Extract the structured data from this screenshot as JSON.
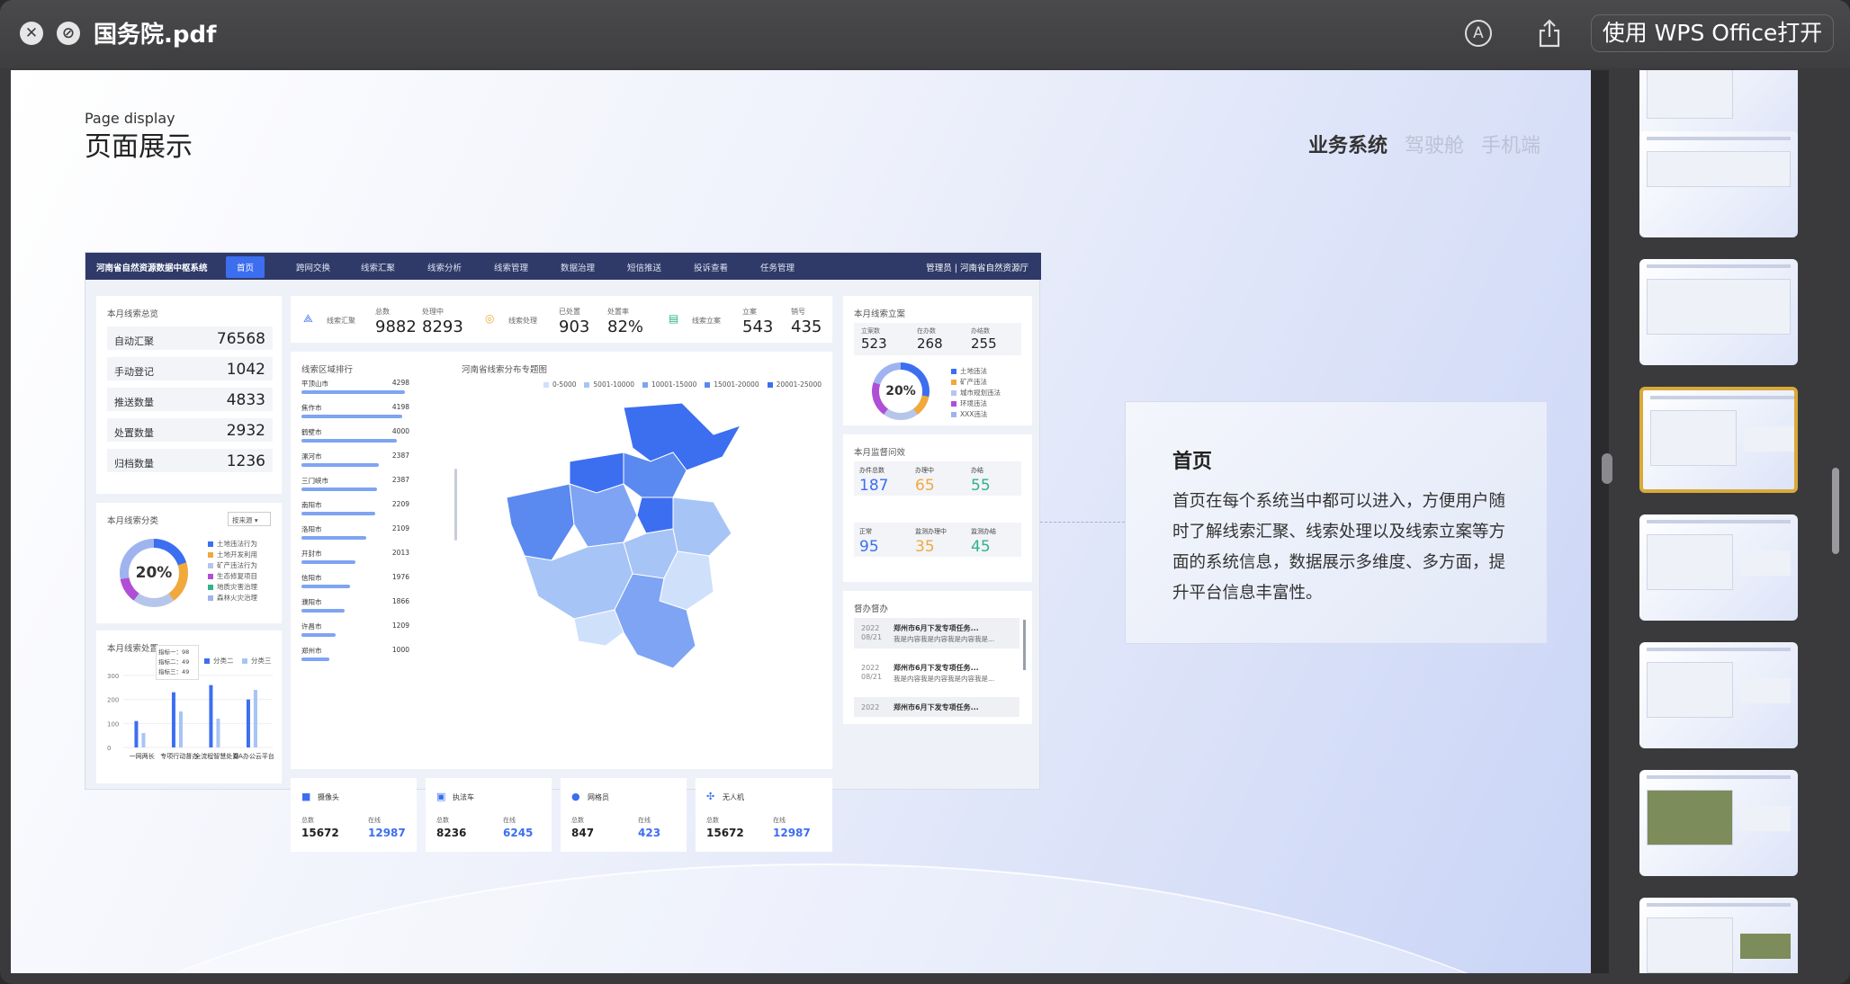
{
  "window": {
    "title": "国务院.pdf",
    "open_with_label": "使用 WPS Office打开",
    "close_icon": "close-icon",
    "sidebar_toggle_icon": "compass-icon",
    "annotate_icon": "markup-icon",
    "share_icon": "share-icon"
  },
  "slide": {
    "heading_en": "Page display",
    "heading_cn": "页面展示",
    "tabs": [
      {
        "label": "业务系统",
        "active": true
      },
      {
        "label": "驾驶舱",
        "active": false
      },
      {
        "label": "手机端",
        "active": false
      }
    ],
    "description": {
      "title": "首页",
      "body": "首页在每个系统当中都可以进入，方便用户随时了解线索汇聚、线索处理以及线索立案等方面的系统信息，数据展示多维度、多方面，提升平台信息丰富性。"
    }
  },
  "mock": {
    "brand": "河南省自然资源数据中枢系统",
    "nav": [
      "首页",
      "跨网交换",
      "线索汇聚",
      "线索分析",
      "线索管理",
      "数据治理",
      "短信推送",
      "投诉查看",
      "任务管理"
    ],
    "user": "管理员 | 河南省自然资源厅",
    "summary": {
      "title": "本月线索总览",
      "rows": [
        {
          "label": "自动汇聚",
          "value": "76568"
        },
        {
          "label": "手动登记",
          "value": "1042"
        },
        {
          "label": "推送数量",
          "value": "4833"
        },
        {
          "label": "处置数量",
          "value": "2932"
        },
        {
          "label": "归档数量",
          "value": "1236"
        }
      ]
    },
    "classify": {
      "title": "本月线索分类",
      "dropdown": "按来源",
      "percent": "20%",
      "legend": [
        "土地违法行为",
        "土地开发利用",
        "矿产违法行为",
        "生态修复项目",
        "地质灾害治理",
        "森林火灾治理"
      ]
    },
    "kpis": [
      {
        "name": "线索汇聚",
        "items": [
          {
            "label": "总数",
            "value": "9882"
          },
          {
            "label": "处理中",
            "value": "8293"
          }
        ]
      },
      {
        "name": "线索处理",
        "items": [
          {
            "label": "已处置",
            "value": "903"
          },
          {
            "label": "处置率",
            "value": "82%"
          }
        ]
      },
      {
        "name": "线索立案",
        "items": [
          {
            "label": "立案",
            "value": "543"
          },
          {
            "label": "销号",
            "value": "435"
          }
        ]
      }
    ],
    "ranking": {
      "title": "线索区域排行",
      "rows": [
        {
          "name": "平顶山市",
          "value": "4298"
        },
        {
          "name": "焦作市",
          "value": "4198"
        },
        {
          "name": "鹤壁市",
          "value": "4000"
        },
        {
          "name": "漯河市",
          "value": "2387"
        },
        {
          "name": "三门峡市",
          "value": "2387"
        },
        {
          "name": "南阳市",
          "value": "2209"
        },
        {
          "name": "洛阳市",
          "value": "2109"
        },
        {
          "name": "开封市",
          "value": "2013"
        },
        {
          "name": "信阳市",
          "value": "1976"
        },
        {
          "name": "濮阳市",
          "value": "1866"
        },
        {
          "name": "许昌市",
          "value": "1209"
        },
        {
          "name": "郑州市",
          "value": "1000"
        }
      ],
      "bar_fractions": [
        0.96,
        0.93,
        0.88,
        0.72,
        0.7,
        0.68,
        0.6,
        0.5,
        0.45,
        0.4,
        0.32,
        0.26
      ]
    },
    "map": {
      "title": "河南省线索分布专题图",
      "legend": [
        "0-5000",
        "5001-10000",
        "10001-15000",
        "15001-20000",
        "20001-25000"
      ],
      "colors": [
        "#cfe0fb",
        "#a7c4f6",
        "#7ea4f3",
        "#5a89ef",
        "#3c6ef0"
      ]
    },
    "filing": {
      "title": "本月线索立案",
      "items": [
        {
          "label": "立案数",
          "value": "523"
        },
        {
          "label": "在办数",
          "value": "268"
        },
        {
          "label": "办结数",
          "value": "255"
        }
      ],
      "percent": "20%",
      "legend": [
        "土地违法",
        "矿产违法",
        "城市规划违法",
        "环境违法",
        "XXX违法"
      ]
    },
    "supervision": {
      "title": "本月监督问效",
      "items": [
        {
          "label": "办件总数",
          "value": "187",
          "color": "#3c6ef0"
        },
        {
          "label": "办理中",
          "value": "65",
          "color": "#f0a93c"
        },
        {
          "label": "办结",
          "value": "55",
          "color": "#2fb38a"
        },
        {
          "label": "正常",
          "value": "95",
          "color": "#3c6ef0"
        },
        {
          "label": "监测办理中",
          "value": "35",
          "color": "#f0a93c"
        },
        {
          "label": "监测办结",
          "value": "45",
          "color": "#2fb38a"
        }
      ]
    },
    "notices": {
      "title": "督办督办",
      "items": [
        {
          "year": "2022",
          "date": "08/21",
          "title": "郑州市6月下发专项任务...",
          "desc": "我是内容我是内容我是内容我是..."
        },
        {
          "year": "2022",
          "date": "08/21",
          "title": "郑州市6月下发专项任务...",
          "desc": "我是内容我是内容我是内容我是..."
        },
        {
          "year": "2022",
          "date": "",
          "title": "郑州市6月下发专项任务...",
          "desc": ""
        }
      ]
    },
    "handling": {
      "title": "本月线索处置",
      "legend": [
        "分类二",
        "分类三"
      ],
      "tooltip": [
        "指标一：98",
        "指标二：49",
        "指标三：49"
      ],
      "yticks": [
        "300",
        "200",
        "100",
        "0"
      ],
      "categories": [
        "一网两长",
        "专项行动督办",
        "全流程智慧处置",
        "OA办公云平台"
      ]
    },
    "devices": [
      {
        "name": "摄像头",
        "l1": "总数",
        "v1": "15672",
        "l2": "在线",
        "v2": "12987"
      },
      {
        "name": "执法车",
        "l1": "总数",
        "v1": "8236",
        "l2": "在线",
        "v2": "6245"
      },
      {
        "name": "网格员",
        "l1": "总数",
        "v1": "847",
        "l2": "在线",
        "v2": "423"
      },
      {
        "name": "无人机",
        "l1": "总数",
        "v1": "15672",
        "l2": "在线",
        "v2": "12987"
      }
    ]
  },
  "chart_data": {
    "type": "bar",
    "title": "本月线索处置",
    "categories": [
      "一网两长",
      "专项行动督办",
      "全流程智慧处置",
      "OA办公云平台"
    ],
    "series": [
      {
        "name": "分类二",
        "values": [
          110,
          230,
          260,
          200
        ]
      },
      {
        "name": "分类三",
        "values": [
          60,
          150,
          120,
          240
        ]
      }
    ],
    "ylim": [
      0,
      300
    ]
  }
}
